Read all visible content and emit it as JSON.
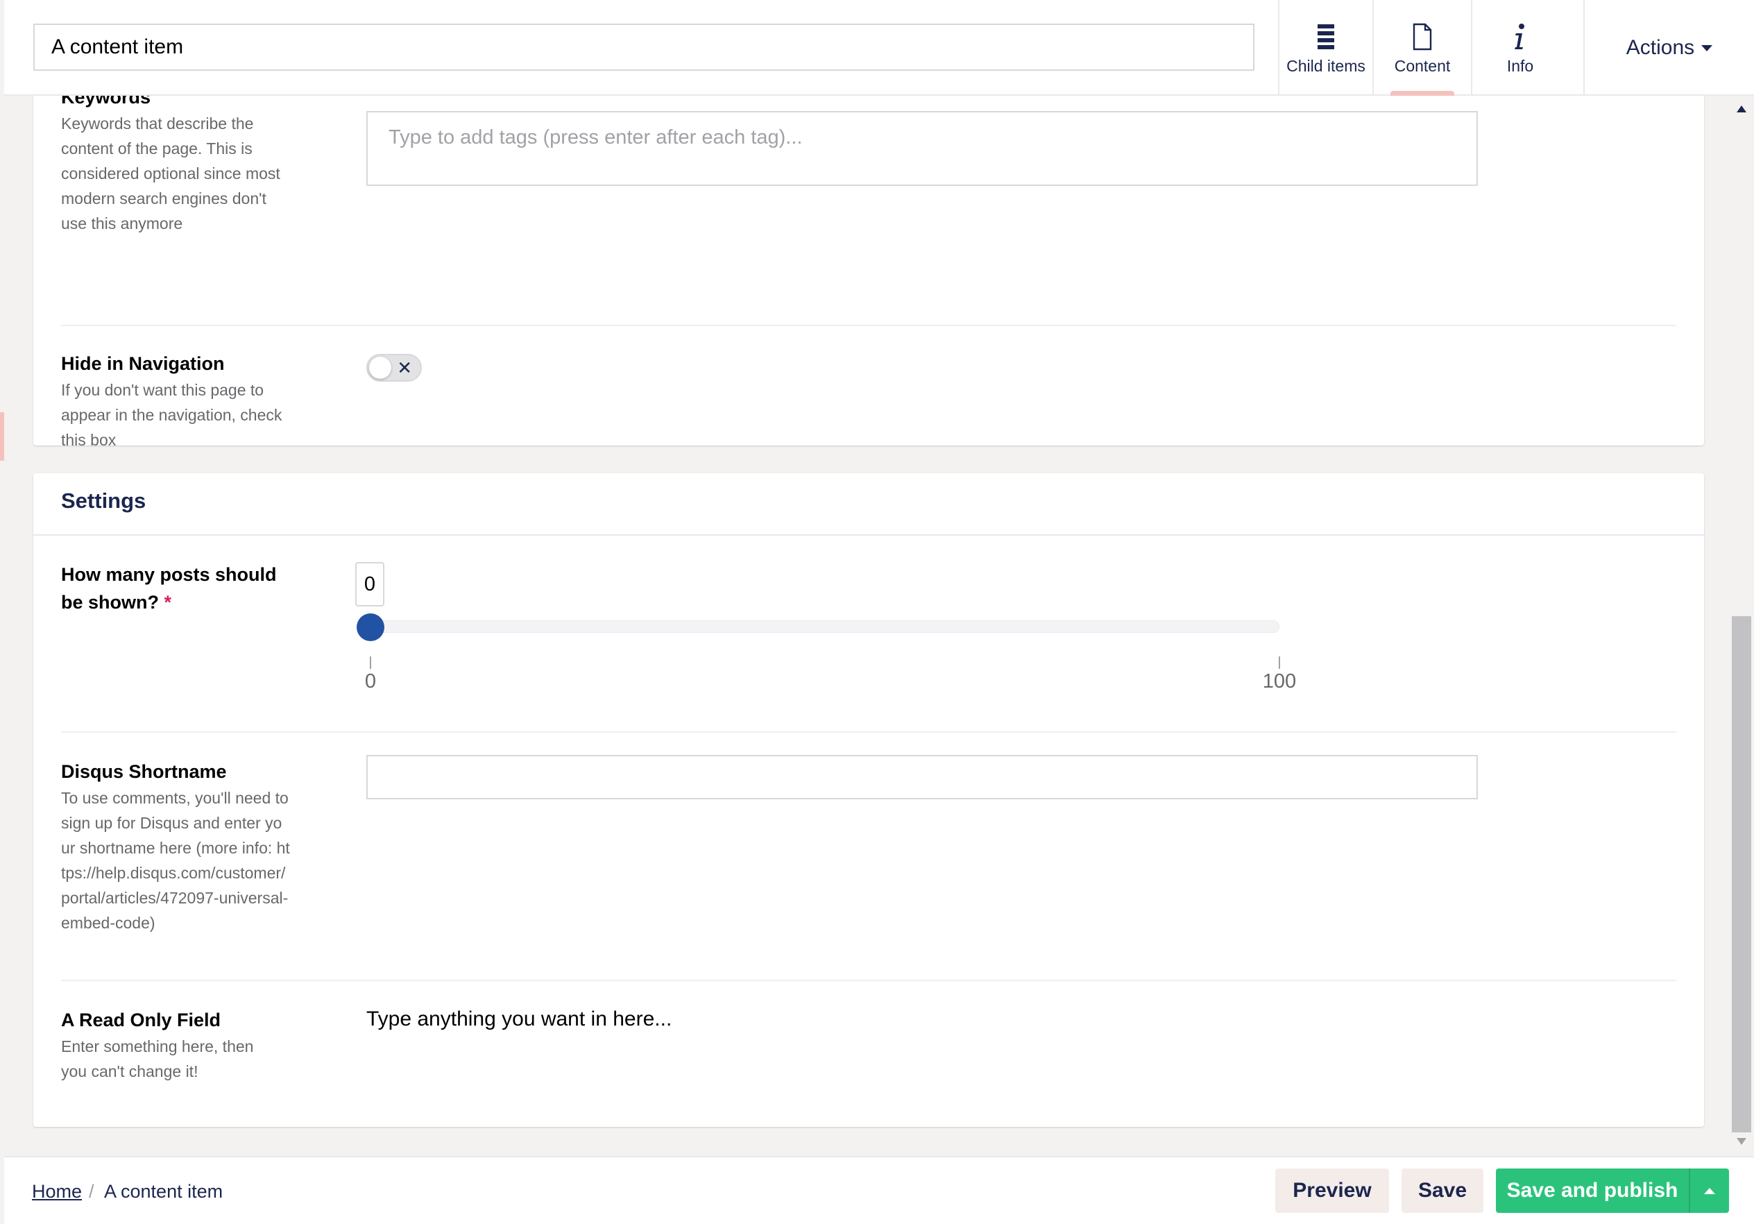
{
  "header": {
    "name_value": "A content item",
    "apps": [
      {
        "label": "Child items",
        "icon": "list-icon"
      },
      {
        "label": "Content",
        "icon": "document-icon",
        "active": true
      },
      {
        "label": "Info",
        "icon": "info-icon"
      }
    ],
    "actions_label": "Actions"
  },
  "seo_panel": {
    "keywords": {
      "label": "Keywords",
      "description": "Keywords that describe the content of the page. This is considered optional since most modern search engines don't use this anymore",
      "placeholder": "Type to add tags (press enter after each tag)..."
    },
    "hide_nav": {
      "label": "Hide in Navigation",
      "description": "If you don't want this page to appear in the navigation, check this box",
      "toggled": false
    }
  },
  "settings_panel": {
    "title": "Settings",
    "posts": {
      "label": "How many posts should be shown?",
      "required_mark": "*",
      "value": "0",
      "min_label": "0",
      "max_label": "100",
      "fraction": 0
    },
    "disqus": {
      "label": "Disqus Shortname",
      "description": "To use comments, you'll need to sign up for Disqus and enter your shortname here (more info: https://help.disqus.com/customer/portal/articles/472097-universal-embed-code)",
      "value": ""
    },
    "readonly": {
      "label": "A Read Only Field",
      "description": "Enter something here, then you can't change it!",
      "value": "Type anything you want in here..."
    }
  },
  "footer": {
    "breadcrumb_home": "Home",
    "breadcrumb_sep": "/",
    "breadcrumb_current": "A content item",
    "preview_label": "Preview",
    "save_label": "Save",
    "publish_label": "Save and publish"
  },
  "colors": {
    "primary": "#1b264f",
    "publish_green": "#2bc37c",
    "slider_blue": "#2152a3",
    "active_tab_accent": "#f5c1bc",
    "required_red": "#d42054"
  }
}
